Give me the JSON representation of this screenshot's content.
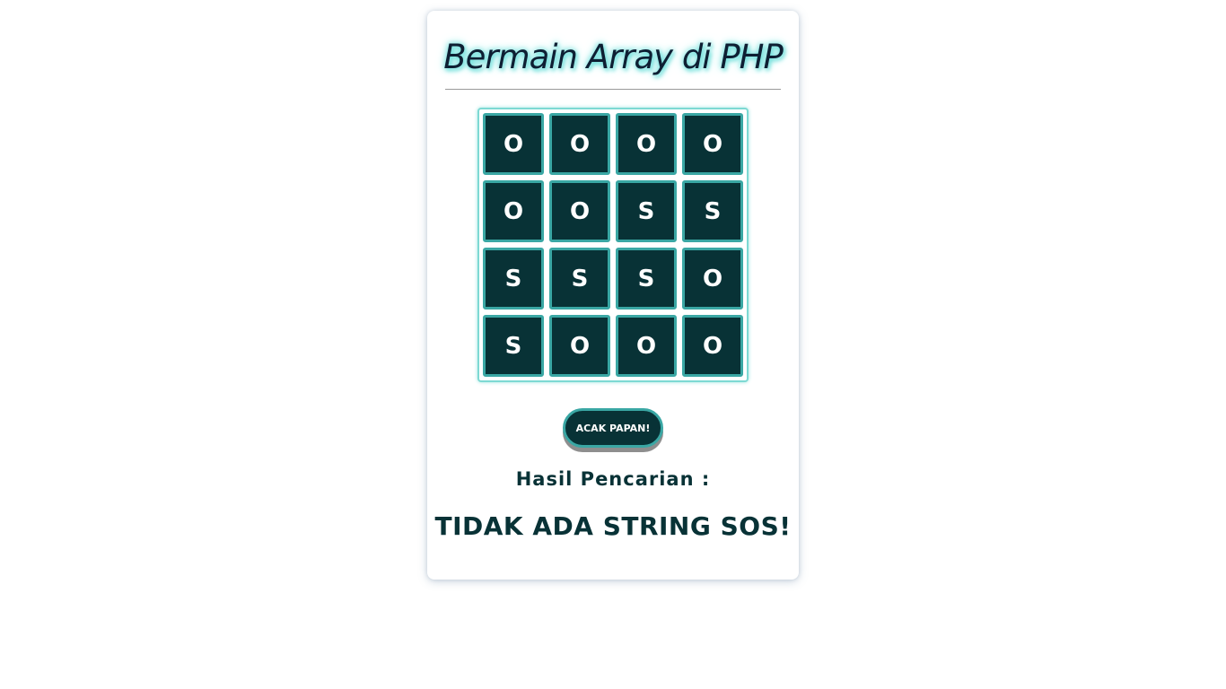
{
  "page": {
    "title": "Bermain Array di PHP"
  },
  "board": {
    "rows": [
      [
        "O",
        "O",
        "O",
        "O"
      ],
      [
        "O",
        "O",
        "S",
        "S"
      ],
      [
        "S",
        "S",
        "S",
        "O"
      ],
      [
        "S",
        "O",
        "O",
        "O"
      ]
    ]
  },
  "controls": {
    "shuffle_label": "ACAK PAPAN!"
  },
  "result": {
    "label": "Hasil Pencarian :",
    "value": "TIDAK ADA STRING SOS!"
  },
  "colors": {
    "tile_background": "#083236",
    "tile_border": "#3aa7a4",
    "board_border": "#7dd9d3",
    "text_dark": "#083236",
    "title_glow": "#6fe0dc"
  }
}
